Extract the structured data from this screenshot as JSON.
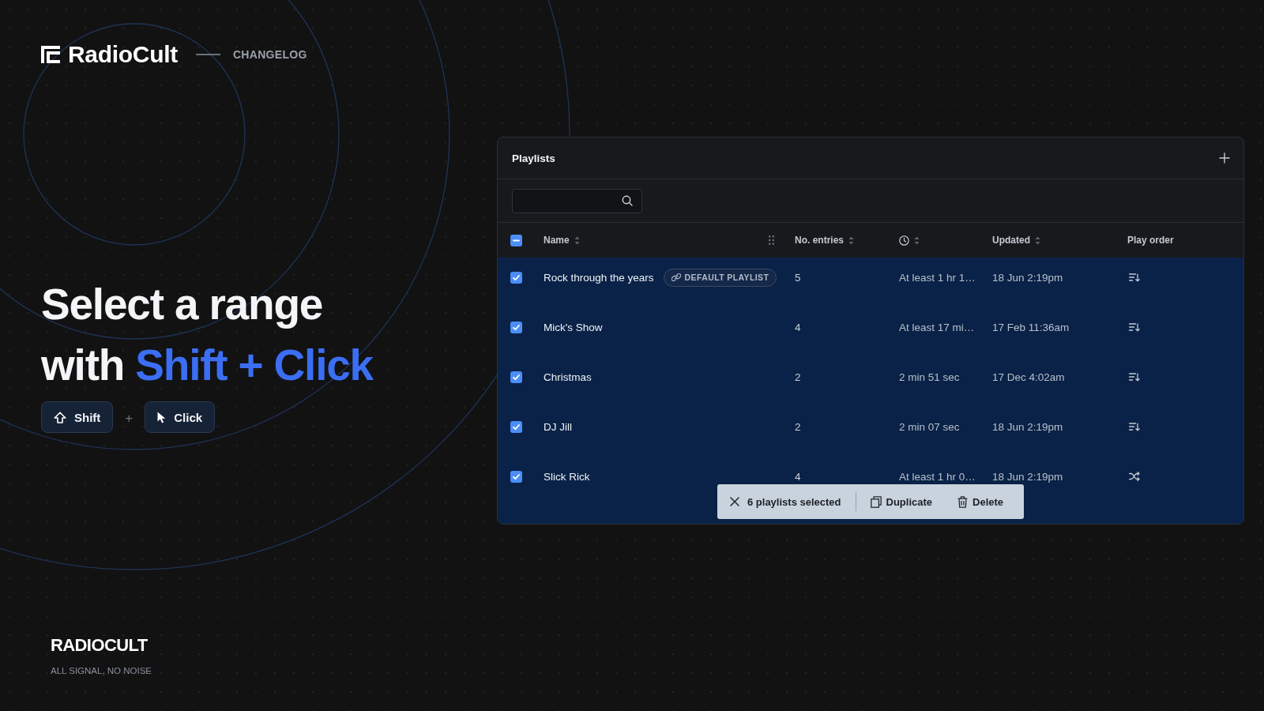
{
  "brand": {
    "name": "RadioCult",
    "section": "CHANGELOG"
  },
  "hero": {
    "heading": "Select a range\nwith **Shift + Click**",
    "keys": [
      {
        "kind": "shift",
        "label": "Shift"
      },
      {
        "kind": "click",
        "label": "Click"
      }
    ],
    "joiner": "+"
  },
  "playlists": {
    "title": "Playlists",
    "select_all": {
      "indeterminate": true
    },
    "columns": [
      {
        "kind": "text",
        "label": "Name",
        "sortable": true,
        "grip": true
      },
      {
        "kind": "text",
        "label": "No. entries",
        "sortable": true,
        "grip": false
      },
      {
        "kind": "clock",
        "sortable": true,
        "grip": false
      },
      {
        "kind": "text",
        "label": "Updated",
        "sortable": true,
        "grip": false
      },
      {
        "kind": "text",
        "label": "Play order",
        "sortable": false,
        "grip": false
      }
    ],
    "rows": [
      {
        "selected": true,
        "name": "Rock through the years",
        "badge": "DEFAULT PLAYLIST",
        "entries": "5",
        "duration": "At least 1 hr 1…",
        "updated": "18 Jun 2:19pm",
        "play_order": {
          "kind": "sequential"
        }
      },
      {
        "selected": true,
        "name": "Mick's Show",
        "entries": "4",
        "duration": "At least 17 mi…",
        "updated": "17 Feb 11:36am",
        "play_order": {
          "kind": "sequential"
        }
      },
      {
        "selected": true,
        "name": "Christmas",
        "entries": "2",
        "duration": "2 min 51 sec",
        "updated": "17 Dec 4:02am",
        "play_order": {
          "kind": "sequential"
        }
      },
      {
        "selected": true,
        "name": "DJ Jill",
        "entries": "2",
        "duration": "2 min 07 sec",
        "updated": "18 Jun 2:19pm",
        "play_order": {
          "kind": "sequential"
        }
      },
      {
        "selected": true,
        "name": "Slick Rick",
        "entries": "4",
        "duration": "At least 1 hr 0…",
        "updated": "18 Jun 2:19pm",
        "play_order": {
          "kind": "shuffle"
        }
      }
    ],
    "selection_bar": {
      "count": "6 playlists selected",
      "actions": [
        {
          "kind": "duplicate",
          "label": "Duplicate"
        },
        {
          "kind": "delete",
          "label": "Delete"
        }
      ]
    }
  },
  "footer": {
    "name": "RADIOCULT",
    "tagline": "ALL SIGNAL, NO NOISE"
  }
}
